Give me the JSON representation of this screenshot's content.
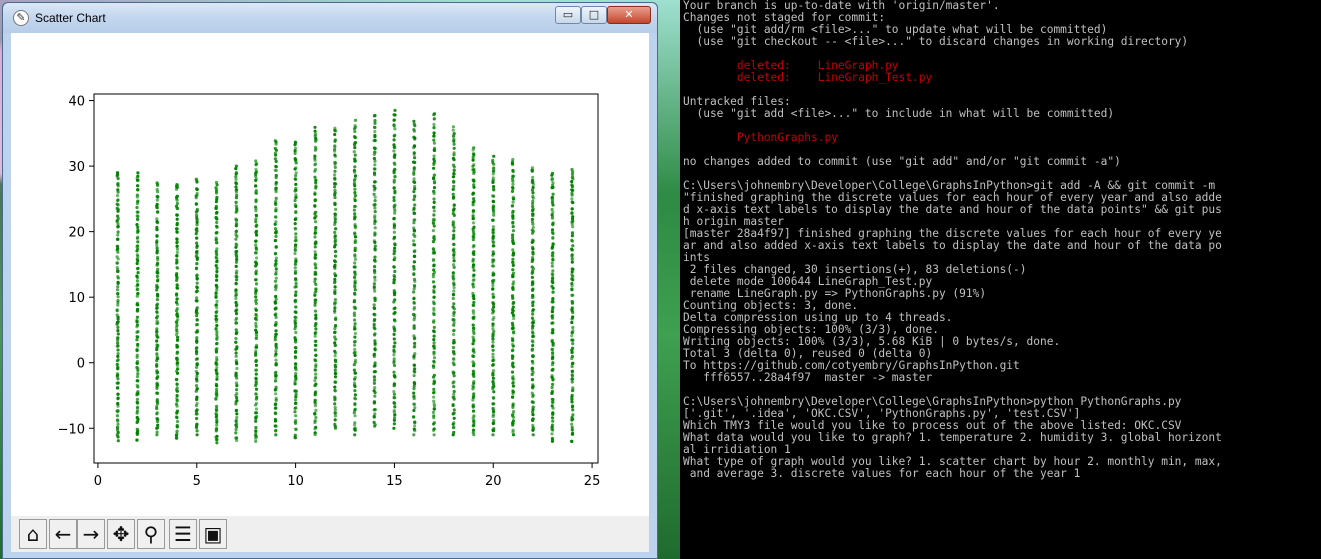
{
  "window": {
    "title": "Scatter Chart",
    "icon": "matplotlib-icon",
    "controls": {
      "minimize": "▭",
      "maximize": "□",
      "close": "✕"
    }
  },
  "toolbar": [
    {
      "name": "home-icon",
      "glyph": "⌂"
    },
    {
      "name": "back-arrow-icon",
      "glyph": "←"
    },
    {
      "name": "forward-arrow-icon",
      "glyph": "→"
    },
    {
      "name": "pan-icon",
      "glyph": "✥"
    },
    {
      "name": "zoom-icon",
      "glyph": "⚲"
    },
    {
      "name": "configure-subplots-icon",
      "glyph": "☰"
    },
    {
      "name": "save-icon",
      "glyph": "▣"
    }
  ],
  "chart_data": {
    "type": "scatter",
    "marker_color": "#008000",
    "xlim": [
      -0.2,
      25.3
    ],
    "ylim": [
      -15.3,
      41
    ],
    "xticks": [
      0,
      5,
      10,
      15,
      20,
      25
    ],
    "yticks": [
      -10,
      0,
      10,
      20,
      30,
      40
    ],
    "grid": false,
    "series": [
      {
        "x": [
          1,
          2,
          3,
          4,
          5,
          6,
          7,
          8,
          9,
          10,
          11,
          12,
          13,
          14,
          15,
          16,
          17,
          18,
          19,
          20,
          21,
          22,
          23,
          24
        ],
        "y_min": [
          -12,
          -12,
          -11,
          -11.5,
          -11,
          -12.5,
          -12,
          -12,
          -11,
          -11.5,
          -11,
          -10,
          -11,
          -10,
          -10,
          -11,
          -11,
          -11,
          -11,
          -11,
          -11,
          -11,
          -12,
          -12
        ],
        "y_max": [
          29,
          29,
          27.5,
          27.5,
          28,
          27.5,
          30,
          31,
          34,
          34,
          36,
          36,
          37,
          38,
          38.5,
          37,
          38,
          36,
          33,
          31.5,
          31,
          30,
          29,
          29.5
        ]
      }
    ]
  },
  "terminal": {
    "lines": [
      {
        "text": "Your branch is up-to-date with 'origin/master'.",
        "style": ""
      },
      {
        "text": "Changes not staged for commit:",
        "style": ""
      },
      {
        "text": "  (use \"git add/rm <file>...\" to update what will be committed)",
        "style": ""
      },
      {
        "text": "  (use \"git checkout -- <file>...\" to discard changes in working directory)",
        "style": ""
      },
      {
        "text": "",
        "style": ""
      },
      {
        "text": "        deleted:    LineGraph.py",
        "style": "red"
      },
      {
        "text": "        deleted:    LineGraph_Test.py",
        "style": "red"
      },
      {
        "text": "",
        "style": ""
      },
      {
        "text": "Untracked files:",
        "style": ""
      },
      {
        "text": "  (use \"git add <file>...\" to include in what will be committed)",
        "style": ""
      },
      {
        "text": "",
        "style": ""
      },
      {
        "text": "        PythonGraphs.py",
        "style": "red"
      },
      {
        "text": "",
        "style": ""
      },
      {
        "text": "no changes added to commit (use \"git add\" and/or \"git commit -a\")",
        "style": ""
      },
      {
        "text": "",
        "style": ""
      },
      {
        "text": "C:\\Users\\johnembry\\Developer\\College\\GraphsInPython>git add -A && git commit -m",
        "style": ""
      },
      {
        "text": "\"finished graphing the discrete values for each hour of every year and also adde",
        "style": ""
      },
      {
        "text": "d x-axis text labels to display the date and hour of the data points\" && git pus",
        "style": ""
      },
      {
        "text": "h origin master",
        "style": ""
      },
      {
        "text": "[master 28a4f97] finished graphing the discrete values for each hour of every ye",
        "style": ""
      },
      {
        "text": "ar and also added x-axis text labels to display the date and hour of the data po",
        "style": ""
      },
      {
        "text": "ints",
        "style": ""
      },
      {
        "text": " 2 files changed, 30 insertions(+), 83 deletions(-)",
        "style": ""
      },
      {
        "text": " delete mode 100644 LineGraph_Test.py",
        "style": ""
      },
      {
        "text": " rename LineGraph.py => PythonGraphs.py (91%)",
        "style": ""
      },
      {
        "text": "Counting objects: 3, done.",
        "style": ""
      },
      {
        "text": "Delta compression using up to 4 threads.",
        "style": ""
      },
      {
        "text": "Compressing objects: 100% (3/3), done.",
        "style": ""
      },
      {
        "text": "Writing objects: 100% (3/3), 5.68 KiB | 0 bytes/s, done.",
        "style": ""
      },
      {
        "text": "Total 3 (delta 0), reused 0 (delta 0)",
        "style": ""
      },
      {
        "text": "To https://github.com/cotyembry/GraphsInPython.git",
        "style": ""
      },
      {
        "text": "   fff6557..28a4f97  master -> master",
        "style": ""
      },
      {
        "text": "",
        "style": ""
      },
      {
        "text": "C:\\Users\\johnembry\\Developer\\College\\GraphsInPython>python PythonGraphs.py",
        "style": ""
      },
      {
        "text": "['.git', '.idea', 'OKC.CSV', 'PythonGraphs.py', 'test.CSV']",
        "style": ""
      },
      {
        "text": "Which TMY3 file would you like to process out of the above listed: OKC.CSV",
        "style": ""
      },
      {
        "text": "What data would you like to graph? 1. temperature 2. humidity 3. global horizont",
        "style": ""
      },
      {
        "text": "al irridiation 1",
        "style": ""
      },
      {
        "text": "What type of graph would you like? 1. scatter chart by hour 2. monthly min, max,",
        "style": ""
      },
      {
        "text": " and average 3. discrete values for each hour of the year 1",
        "style": ""
      }
    ]
  }
}
